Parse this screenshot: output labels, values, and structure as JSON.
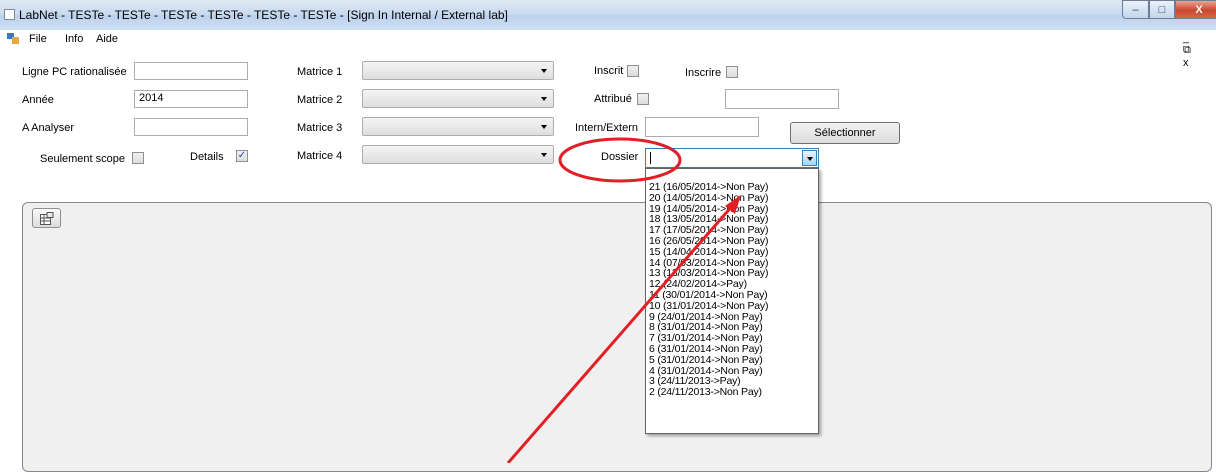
{
  "window": {
    "title": "LabNet - TESTe  -  TESTe  -  TESTe  -  TESTe  -  TESTe  -  TESTe - [Sign In Internal / External lab]",
    "minimize_glyph": "–",
    "maximize_glyph": "□",
    "close_glyph": "X"
  },
  "menu": {
    "items": [
      "File",
      "Info",
      "Aide"
    ],
    "mdi_controls": "_ ⧉ x"
  },
  "form": {
    "ligne_pc": {
      "label": "Ligne PC rationalisée",
      "value": ""
    },
    "annee": {
      "label": "Année",
      "value": "2014"
    },
    "a_analyser": {
      "label": "A Analyser",
      "value": ""
    },
    "seulement_scope": {
      "label": "Seulement scope",
      "checked": false
    },
    "details": {
      "label": "Details",
      "checked": true
    },
    "matrices": [
      {
        "label": "Matrice 1",
        "value": ""
      },
      {
        "label": "Matrice 2",
        "value": ""
      },
      {
        "label": "Matrice 3",
        "value": ""
      },
      {
        "label": "Matrice 4",
        "value": ""
      }
    ],
    "inscrit": {
      "label": "Inscrit",
      "checked": false
    },
    "inscrire": {
      "label": "Inscrire",
      "checked": false
    },
    "attribue": {
      "label": "Attribué",
      "checked": false
    },
    "attribue_select": {
      "value": ""
    },
    "intern_extern": {
      "label": "Intern/Extern",
      "value": ""
    },
    "selectionner_label": "Sélectionner",
    "dossier": {
      "label": "Dossier",
      "value": ""
    }
  },
  "dossier_options": [
    "21 (16/05/2014->Non Pay)",
    "20 (14/05/2014->Non Pay)",
    "19 (14/05/2014->Non Pay)",
    "18 (13/05/2014->Non Pay)",
    "17 (17/05/2014->Non Pay)",
    "16 (26/05/2014->Non Pay)",
    "15 (14/04/2014->Non Pay)",
    "14 (07/03/2014->Non Pay)",
    "13 (13/03/2014->Non Pay)",
    "12 (24/02/2014->Pay)",
    "11 (30/01/2014->Non Pay)",
    "10 (31/01/2014->Non Pay)",
    "9 (24/01/2014->Non Pay)",
    "8 (31/01/2014->Non Pay)",
    "7 (31/01/2014->Non Pay)",
    "6 (31/01/2014->Non Pay)",
    "5 (31/01/2014->Non Pay)",
    "4 (31/01/2014->Non Pay)",
    "3 (24/11/2013->Pay)",
    "2 (24/11/2013->Non Pay)"
  ],
  "panel": {
    "toolbar_icon": "grid-export-icon"
  },
  "annotation": {
    "color": "#e31e24",
    "shapes": [
      "ellipse around Dossier",
      "arrow pointing to dropdown list"
    ]
  }
}
